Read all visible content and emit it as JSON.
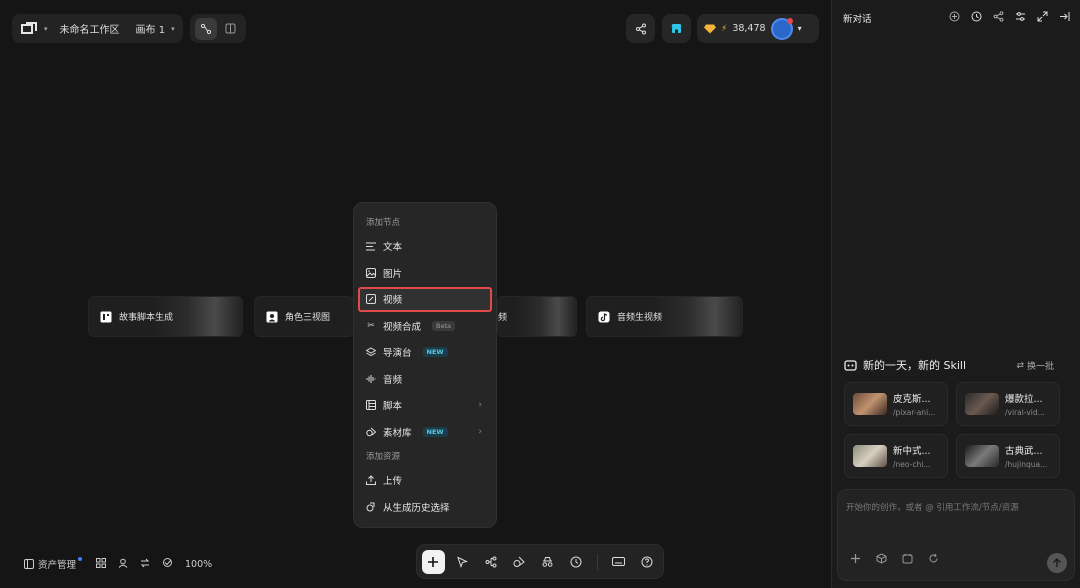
{
  "topbar": {
    "workspace_name": "未命名工作区",
    "canvas_name": "画布 1",
    "credits": "38,478"
  },
  "cards": [
    {
      "label": "故事脚本生成",
      "icon": "storyboard-icon"
    },
    {
      "label": "角色三视图",
      "icon": "portrait-icon"
    },
    {
      "label": "频",
      "icon": "video-icon"
    },
    {
      "label": "音频生视频",
      "icon": "tiktok-icon"
    }
  ],
  "menu": {
    "section_add_node": "添加节点",
    "items": [
      {
        "label": "文本",
        "icon": "text-lines-icon"
      },
      {
        "label": "图片",
        "icon": "image-icon"
      },
      {
        "label": "视频",
        "icon": "video-edit-icon"
      },
      {
        "label": "视频合成",
        "icon": "scissors-icon",
        "badge": "Beta"
      },
      {
        "label": "导演台",
        "icon": "layers-icon",
        "badge": "NEW"
      },
      {
        "label": "音频",
        "icon": "audio-wave-icon"
      },
      {
        "label": "脚本",
        "icon": "script-icon"
      },
      {
        "label": "素材库",
        "icon": "shapes-icon",
        "badge": "NEW"
      }
    ],
    "section_add_resource": "添加资源",
    "resource_items": [
      {
        "label": "上传",
        "icon": "upload-icon"
      },
      {
        "label": "从生成历史选择",
        "icon": "history-icon"
      }
    ]
  },
  "bottom_left": {
    "assets_label": "资产管理",
    "zoom": "100%"
  },
  "panel": {
    "title": "新对话",
    "skill_title": "新的一天，新的 Skill",
    "refresh_label": "换一批",
    "skills": [
      {
        "name": "皮克斯...",
        "slug": "/pixar-ani..."
      },
      {
        "name": "爆款拉...",
        "slug": "/viral-vid..."
      },
      {
        "name": "新中式...",
        "slug": "/neo-chi..."
      },
      {
        "name": "古典武...",
        "slug": "/hujinqua..."
      }
    ],
    "chat_placeholder": "开始你的创作，或者 @ 引用工作流/节点/资源"
  }
}
